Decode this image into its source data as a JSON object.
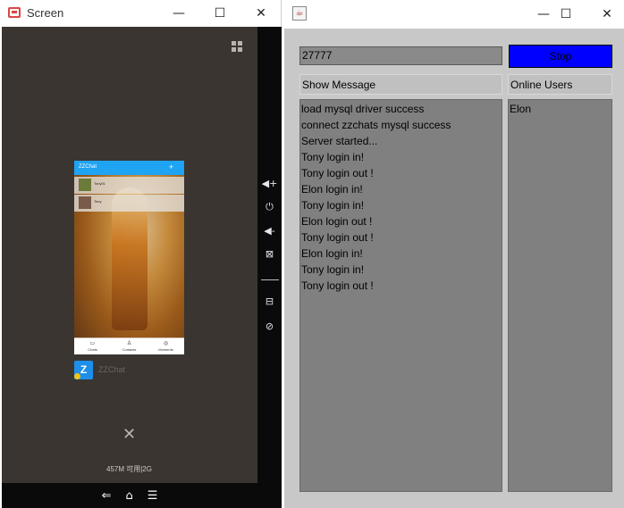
{
  "left_window": {
    "title": "Screen",
    "controls": {
      "minimize": "—",
      "maximize": "☐",
      "close": "✕"
    },
    "card": {
      "app_title": "ZZChat",
      "add_symbol": "+",
      "rows": [
        {
          "name": "Tony01"
        },
        {
          "name": "Tony"
        }
      ],
      "tabs": [
        {
          "label": "Chats",
          "icon": "chat-icon"
        },
        {
          "label": "Contacts",
          "icon": "contacts-icon"
        },
        {
          "label": "Moments",
          "icon": "compass-icon"
        }
      ]
    },
    "app_badge_text": "Z",
    "app_name": "ZZChat",
    "close_symbol": "✕",
    "memory": "457M 可用|2G",
    "side_icons": [
      "volume-up-icon",
      "power-icon",
      "volume-down-icon",
      "screenshot-off-icon",
      "gamepad-icon",
      "hide-icon"
    ],
    "nav_icons": [
      "back-icon",
      "home-icon",
      "menu-icon"
    ]
  },
  "right_window": {
    "controls": {
      "minimize": "—",
      "maximize": "☐",
      "close": "✕"
    },
    "port_value": "27777",
    "stop_label": "Stop",
    "show_message_label": "Show Message",
    "online_users_label": "Online Users",
    "messages": [
      "load mysql driver success",
      "connect zzchats mysql success",
      "Server started...",
      "Tony login in!",
      "Tony login out !",
      "Elon login in!",
      "Tony login in!",
      "Elon login out !",
      "Tony login out !",
      "Elon login in!",
      "Tony login in!",
      "Tony login out !"
    ],
    "online_users": [
      "Elon"
    ],
    "colors": {
      "stop_button": "#0000ff",
      "panel_bg": "#808080",
      "window_bg": "#c8c8c8"
    }
  }
}
